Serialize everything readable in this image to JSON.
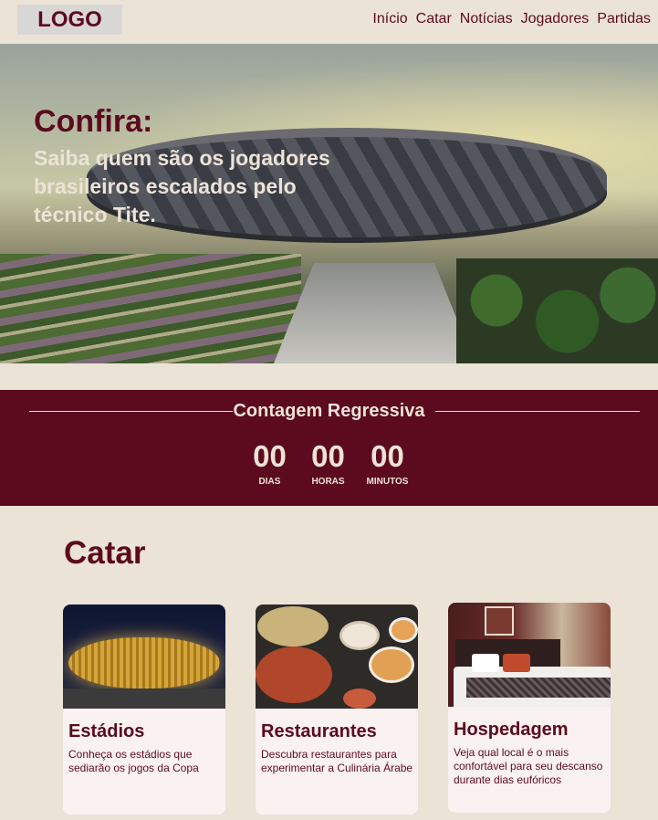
{
  "header": {
    "logo": "LOGO",
    "nav": [
      "Início",
      "Catar",
      "Notícias",
      "Jogadores",
      "Partidas"
    ]
  },
  "hero": {
    "title": "Confira:",
    "text": "Saiba quem são os jogadores brasileiros escalados pelo técnico Tite."
  },
  "countdown": {
    "title": "Contagem Regressiva",
    "units": [
      {
        "value": "00",
        "label": "DIAS"
      },
      {
        "value": "00",
        "label": "HORAS"
      },
      {
        "value": "00",
        "label": "MINUTOS"
      }
    ]
  },
  "catar": {
    "title": "Catar",
    "cards": [
      {
        "title": "Estádios",
        "text": "Conheça os estádios que sediarão os jogos da Copa"
      },
      {
        "title": "Restaurantes",
        "text": "Descubra restaurantes para experimentar a Culinária Árabe"
      },
      {
        "title": "Hospedagem",
        "text": "Veja qual local é o mais confortável para seu descanso durante dias eufóricos"
      }
    ]
  },
  "colors": {
    "brand": "#5c0a1e",
    "background": "#ece3d7",
    "card": "#faf1f1"
  }
}
